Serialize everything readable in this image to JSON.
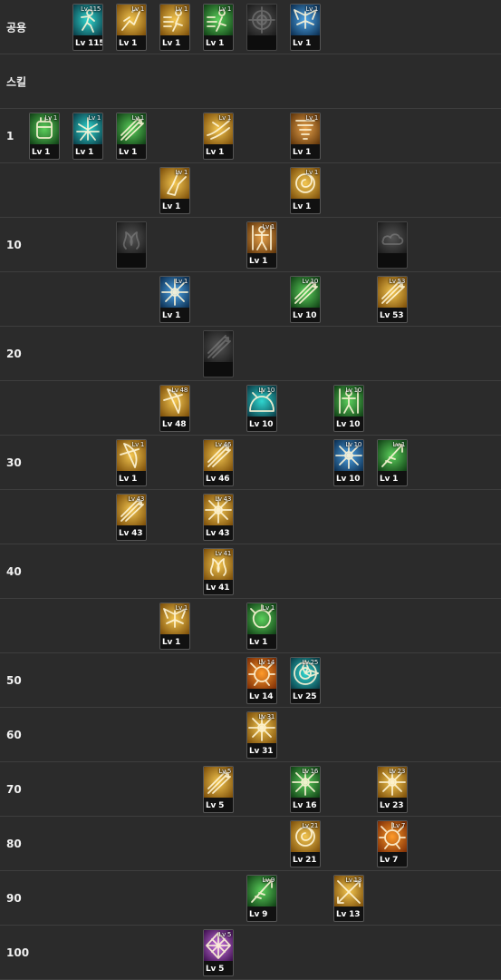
{
  "theme": {
    "gold": [
      "#f3c650",
      "#7a4c08"
    ],
    "green": [
      "#5cd05c",
      "#0f3e14"
    ],
    "teal": [
      "#2fd6cf",
      "#093a45"
    ],
    "brown": [
      "#e6a14a",
      "#5c3208"
    ],
    "darkorange": [
      "#ff9b2a",
      "#7b2b04"
    ],
    "blue": [
      "#4fa6e8",
      "#0a2c4e"
    ],
    "purple": [
      "#d07ae8",
      "#3b0d4c"
    ],
    "gray": [
      "#555555",
      "#1a1a1a"
    ]
  },
  "rows": [
    {
      "label": "공용",
      "skills": [
        {
          "col": 1,
          "tag": "Lv 115",
          "level": "Lv 115",
          "theme": "teal",
          "icon": "runner-icon"
        },
        {
          "col": 2,
          "tag": "Lv 1",
          "level": "Lv 1",
          "theme": "gold",
          "icon": "sprint-icon"
        },
        {
          "col": 3,
          "tag": "Lv 1",
          "level": "Lv 1",
          "theme": "gold",
          "icon": "dash-icon"
        },
        {
          "col": 4,
          "tag": "Lv 1",
          "level": "Lv 1",
          "theme": "green",
          "icon": "dash-icon"
        },
        {
          "col": 5,
          "tag": "",
          "level": "",
          "theme": "gray",
          "icon": "crosshair-icon",
          "locked": true
        },
        {
          "col": 6,
          "tag": "Lv 1",
          "level": "Lv 1",
          "theme": "blue",
          "icon": "wings-icon"
        }
      ]
    },
    {
      "label": "스킬",
      "skills": []
    },
    {
      "label": "1",
      "skills": [
        {
          "col": 0,
          "tag": "Lv 1",
          "level": "Lv 1",
          "theme": "green",
          "icon": "glove-icon"
        },
        {
          "col": 1,
          "tag": "Lv 1",
          "level": "Lv 1",
          "theme": "teal",
          "icon": "aura-icon"
        },
        {
          "col": 2,
          "tag": "Lv 1",
          "level": "Lv 1",
          "theme": "green",
          "icon": "arrows-icon"
        },
        {
          "col": 4,
          "tag": "Lv 1",
          "level": "Lv 1",
          "theme": "gold",
          "icon": "slash-icon"
        },
        {
          "col": 6,
          "tag": "Lv 1",
          "level": "Lv 1",
          "theme": "brown",
          "icon": "tornado-icon"
        }
      ]
    },
    {
      "label": "",
      "skills": [
        {
          "col": 3,
          "tag": "Lv 1",
          "level": "Lv 1",
          "theme": "gold",
          "icon": "kick-icon"
        },
        {
          "col": 6,
          "tag": "Lv 1",
          "level": "Lv 1",
          "theme": "gold",
          "icon": "swirl-icon"
        }
      ]
    },
    {
      "label": "10",
      "skills": [
        {
          "col": 2,
          "tag": "",
          "level": "",
          "theme": "gray",
          "icon": "flame-icon",
          "locked": true
        },
        {
          "col": 5,
          "tag": "Lv 1",
          "level": "Lv 1",
          "theme": "brown",
          "icon": "figure-icon"
        },
        {
          "col": 8,
          "tag": "",
          "level": "",
          "theme": "gray",
          "icon": "cloud-icon",
          "locked": true
        }
      ]
    },
    {
      "label": "",
      "skills": [
        {
          "col": 3,
          "tag": "Lv 1",
          "level": "Lv 1",
          "theme": "blue",
          "icon": "burst-icon"
        },
        {
          "col": 6,
          "tag": "Lv 10",
          "level": "Lv 10",
          "theme": "green",
          "icon": "arrows-icon"
        },
        {
          "col": 8,
          "tag": "Lv 53",
          "level": "Lv 53",
          "theme": "gold",
          "icon": "arrows-icon"
        }
      ]
    },
    {
      "label": "20",
      "skills": [
        {
          "col": 4,
          "tag": "",
          "level": "",
          "theme": "gray",
          "icon": "arrows-icon",
          "locked": true
        }
      ]
    },
    {
      "label": "",
      "skills": [
        {
          "col": 3,
          "tag": "Lv 48",
          "level": "Lv 48",
          "theme": "gold",
          "icon": "bow-icon"
        },
        {
          "col": 5,
          "tag": "Lv 10",
          "level": "Lv 10",
          "theme": "teal",
          "icon": "dome-icon"
        },
        {
          "col": 7,
          "tag": "Lv 10",
          "level": "Lv 10",
          "theme": "green",
          "icon": "figure-icon"
        }
      ]
    },
    {
      "label": "30",
      "skills": [
        {
          "col": 2,
          "tag": "Lv 1",
          "level": "Lv 1",
          "theme": "gold",
          "icon": "bow-icon"
        },
        {
          "col": 4,
          "tag": "Lv 46",
          "level": "Lv 46",
          "theme": "gold",
          "icon": "arrows-icon"
        },
        {
          "col": 7,
          "tag": "Lv 10",
          "level": "Lv 10",
          "theme": "blue",
          "icon": "burst-icon"
        },
        {
          "col": 8,
          "tag": "Lv 1",
          "level": "Lv 1",
          "theme": "green",
          "icon": "arrow-icon"
        }
      ]
    },
    {
      "label": "",
      "skills": [
        {
          "col": 2,
          "tag": "Lv 43",
          "level": "Lv 43",
          "theme": "gold",
          "icon": "arrows-icon"
        },
        {
          "col": 4,
          "tag": "Lv 43",
          "level": "Lv 43",
          "theme": "gold",
          "icon": "burst-icon"
        }
      ]
    },
    {
      "label": "40",
      "skills": [
        {
          "col": 4,
          "tag": "Lv 41",
          "level": "Lv 41",
          "theme": "gold",
          "icon": "flame-icon"
        }
      ]
    },
    {
      "label": "",
      "skills": [
        {
          "col": 3,
          "tag": "Lv 1",
          "level": "Lv 1",
          "theme": "gold",
          "icon": "wings-icon"
        },
        {
          "col": 5,
          "tag": "Lv 1",
          "level": "Lv 1",
          "theme": "green",
          "icon": "splash-icon"
        }
      ]
    },
    {
      "label": "50",
      "skills": [
        {
          "col": 5,
          "tag": "Lv 14",
          "level": "Lv 14",
          "theme": "darkorange",
          "icon": "explosion-icon"
        },
        {
          "col": 6,
          "tag": "Lv 25",
          "level": "Lv 25",
          "theme": "teal",
          "icon": "target-icon"
        }
      ]
    },
    {
      "label": "60",
      "skills": [
        {
          "col": 5,
          "tag": "Lv 31",
          "level": "Lv 31",
          "theme": "gold",
          "icon": "burst-icon"
        }
      ]
    },
    {
      "label": "70",
      "skills": [
        {
          "col": 4,
          "tag": "Lv 5",
          "level": "Lv 5",
          "theme": "gold",
          "icon": "arrows-icon"
        },
        {
          "col": 6,
          "tag": "Lv 16",
          "level": "Lv 16",
          "theme": "green",
          "icon": "burst-icon"
        },
        {
          "col": 8,
          "tag": "Lv 23",
          "level": "Lv 23",
          "theme": "gold",
          "icon": "burst-icon"
        }
      ]
    },
    {
      "label": "80",
      "skills": [
        {
          "col": 6,
          "tag": "Lv 21",
          "level": "Lv 21",
          "theme": "gold",
          "icon": "swirl-icon"
        },
        {
          "col": 8,
          "tag": "Lv 7",
          "level": "Lv 7",
          "theme": "darkorange",
          "icon": "explosion-icon"
        }
      ]
    },
    {
      "label": "90",
      "skills": [
        {
          "col": 5,
          "tag": "Lv 9",
          "level": "Lv 9",
          "theme": "green",
          "icon": "arrow-icon"
        },
        {
          "col": 7,
          "tag": "Lv 13",
          "level": "Lv 13",
          "theme": "gold",
          "icon": "cross-arrows-icon"
        }
      ]
    },
    {
      "label": "100",
      "skills": [
        {
          "col": 4,
          "tag": "Lv 5",
          "level": "Lv 5",
          "theme": "purple",
          "icon": "net-icon"
        }
      ]
    }
  ]
}
